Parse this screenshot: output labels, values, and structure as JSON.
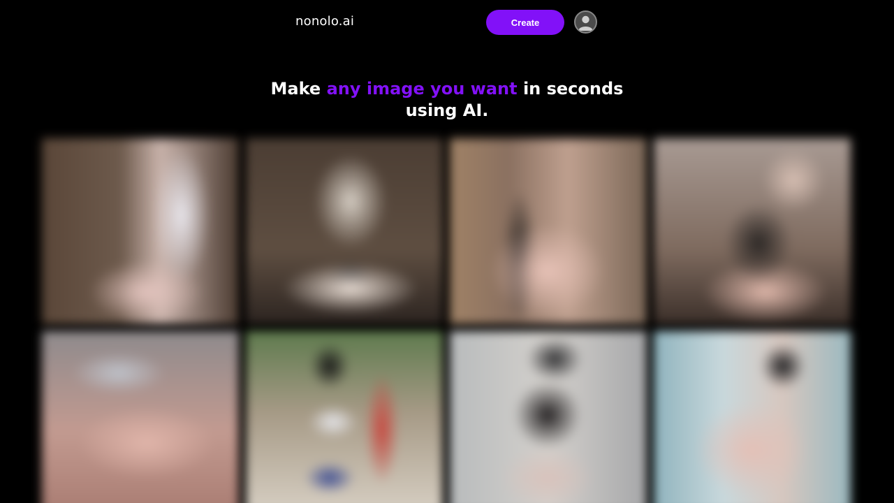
{
  "header": {
    "brand": "nonolo.ai",
    "create_label": "Create",
    "avatar_icon": "user-avatar-icon"
  },
  "hero": {
    "headline_before": "Make ",
    "headline_accent": "any image you want",
    "headline_after": " in seconds using AI.",
    "accent_color": "#8211f8"
  },
  "gallery": {
    "items": [
      {
        "name": "gallery-image-1"
      },
      {
        "name": "gallery-image-2"
      },
      {
        "name": "gallery-image-3"
      },
      {
        "name": "gallery-image-4"
      },
      {
        "name": "gallery-image-5"
      },
      {
        "name": "gallery-image-6"
      },
      {
        "name": "gallery-image-7"
      },
      {
        "name": "gallery-image-8"
      }
    ],
    "blurred": true
  },
  "colors": {
    "background": "#000000",
    "brand_purple": "#8211f8",
    "text": "#ffffff"
  }
}
